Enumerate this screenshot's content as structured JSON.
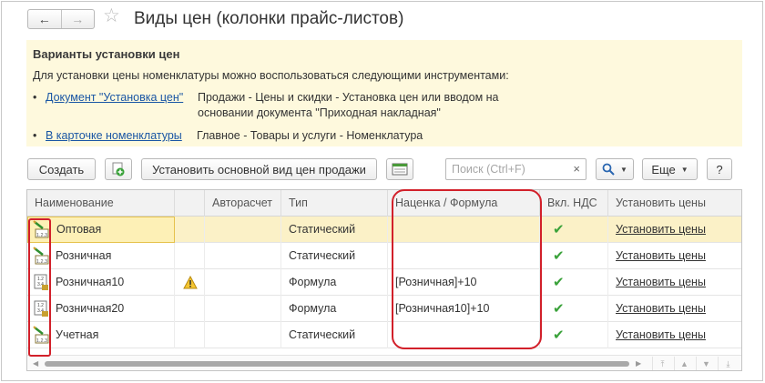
{
  "window": {
    "title": "Виды цен (колонки прайс-листов)",
    "nav_back": "←",
    "nav_forward": "→",
    "favorite_glyph": "☆"
  },
  "info": {
    "heading": "Варианты установки цен",
    "description": "Для установки цены номенклатуры можно воспользоваться следующими инструментами:",
    "items": [
      {
        "bullet": "•",
        "link": "Документ \"Установка цен\"",
        "text": "Продажи - Цены и скидки - Установка цен или вводом на основании документа \"Приходная накладная\""
      },
      {
        "bullet": "•",
        "link": "В карточке номенклатуры",
        "text": "Главное - Товары и услуги - Номенклатура"
      }
    ]
  },
  "toolbar": {
    "create_label": "Создать",
    "set_main_label": "Установить основной вид цен продажи",
    "search_placeholder": "Поиск (Ctrl+F)",
    "search_clear": "×",
    "more_label": "Еще",
    "help_label": "?",
    "caret": "▼"
  },
  "table": {
    "columns": [
      "Наименование",
      "",
      "Авторасчет",
      "Тип",
      "Наценка / Формула",
      "Вкл. НДС",
      "Установить цены"
    ],
    "rows": [
      {
        "name": "Оптовая",
        "icon": "static-price-icon",
        "warning": false,
        "type": "Статический",
        "formula": "",
        "vat": "✔",
        "action": "Установить цены",
        "selected": true
      },
      {
        "name": "Розничная",
        "icon": "static-price-icon",
        "warning": false,
        "type": "Статический",
        "formula": "",
        "vat": "✔",
        "action": "Установить цены",
        "selected": false
      },
      {
        "name": "Розничная10",
        "icon": "formula-price-icon",
        "warning": true,
        "type": "Формула",
        "formula": "[Розничная]+10",
        "vat": "✔",
        "action": "Установить цены",
        "selected": false
      },
      {
        "name": "Розничная20",
        "icon": "formula-price-icon",
        "warning": false,
        "type": "Формула",
        "formula": "[Розничная10]+10",
        "vat": "✔",
        "action": "Установить цены",
        "selected": false
      },
      {
        "name": "Учетная",
        "icon": "static-price-icon",
        "warning": false,
        "type": "Статический",
        "formula": "",
        "vat": "✔",
        "action": "Установить цены",
        "selected": false
      }
    ]
  },
  "colors": {
    "info_background": "#fef9dd",
    "link": "#1a56a4",
    "selected_row": "#fbf1c7",
    "check": "#3aa23a",
    "highlight_box": "#d2202a"
  }
}
